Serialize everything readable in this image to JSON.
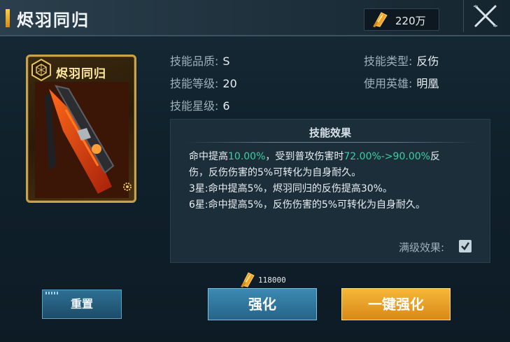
{
  "header": {
    "title": "烬羽同归",
    "currency_value": "220万",
    "currency_icon": "gold-feather-gem-icon",
    "close_icon": "close-icon"
  },
  "card": {
    "name": "烬羽同归",
    "emblem_icon": "hexagon-emblem-icon",
    "art_icon": "weapon-art-icon",
    "gear_icon": "gear-icon"
  },
  "stats": {
    "quality_label": "技能品质:",
    "quality_value": "S",
    "level_label": "技能等级:",
    "level_value": "20",
    "star_label": "技能星级:",
    "star_value": "6",
    "type_label": "技能类型:",
    "type_value": "反伤",
    "hero_label": "使用英雄:",
    "hero_value": "明凰"
  },
  "effect": {
    "title": "技能效果",
    "line1_a": "命中提高",
    "line1_b": "10.00%",
    "line1_c": "，受到普攻伤害时",
    "line1_d": "72.00%->90.00%",
    "line1_e": "反",
    "line2": "伤，反伤伤害的5%可转化为自身耐久。",
    "line3": "3星:命中提高5%，烬羽同归的反伤提高30%。",
    "line4": "6星:命中提高5%，反伤伤害的5%可转化为自身耐久。",
    "max_effect_label": "满级效果:",
    "max_effect_checked": true
  },
  "cost": {
    "value": "118000",
    "icon": "gold-feather-gem-icon"
  },
  "buttons": {
    "reset": "重置",
    "enhance": "强化",
    "one_key_enhance": "一键强化"
  },
  "colors": {
    "highlight_green": "#3ccfa4",
    "gold_button": "#f5b83a",
    "blue_button": "#3b8ab3"
  }
}
